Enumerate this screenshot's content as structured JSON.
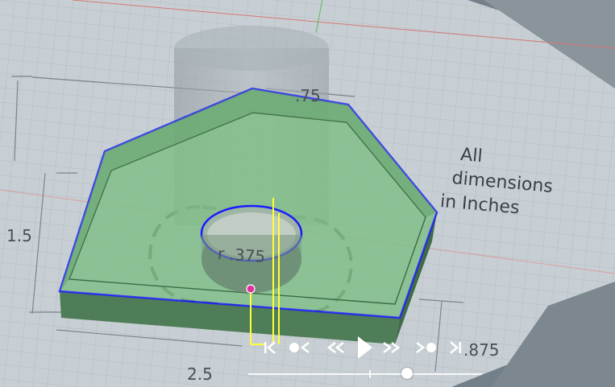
{
  "scene": {
    "dimension_labels": {
      "top_width": ".75",
      "left_height": "1.5",
      "bottom_width": "2.5",
      "right_height": ".875",
      "hole_radius": "r .375"
    },
    "note_lines": [
      "All",
      "dimensions",
      "in Inches"
    ]
  },
  "playback": {
    "buttons": [
      {
        "name": "skip-to-start-button",
        "icon": "skip-to-start-icon"
      },
      {
        "name": "step-back-button",
        "icon": "step-back-icon"
      },
      {
        "name": "rewind-button",
        "icon": "rewind-icon"
      },
      {
        "name": "play-button",
        "icon": "play-icon"
      },
      {
        "name": "fast-forward-button",
        "icon": "fast-forward-icon"
      },
      {
        "name": "step-forward-button",
        "icon": "step-forward-icon"
      },
      {
        "name": "skip-to-end-button",
        "icon": "skip-to-end-icon"
      }
    ],
    "timeline": {
      "tick_fraction": 0.52,
      "handle_fraction": 0.68
    }
  },
  "colors": {
    "part_fill": "#7fbf86",
    "part_edge": "#1a1aff",
    "sketch_plane": "#c9d1d6",
    "highlight": "#ffff33",
    "point": "#e0309a"
  }
}
